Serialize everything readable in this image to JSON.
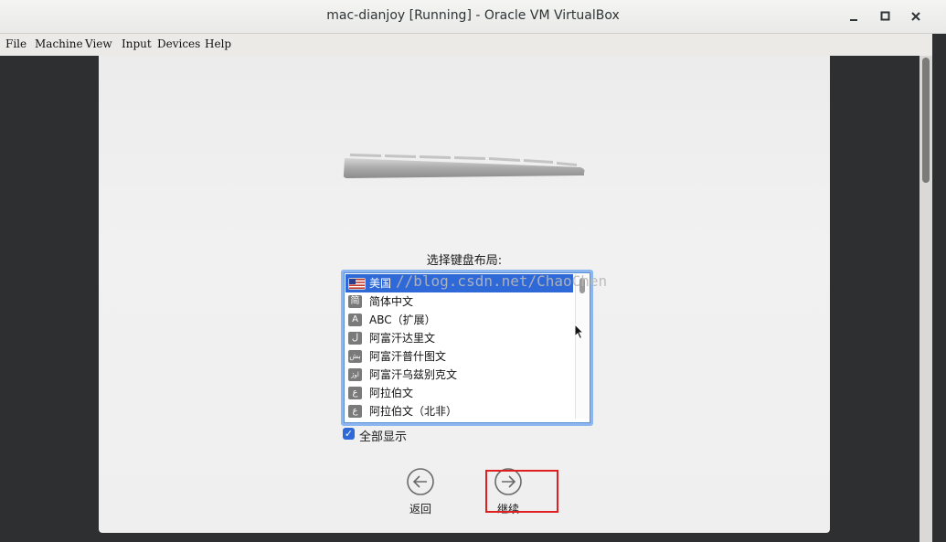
{
  "window": {
    "title": "mac-dianjoy [Running] - Oracle VM VirtualBox",
    "controls": [
      "minimize-icon",
      "maximize-icon",
      "close-icon"
    ]
  },
  "menubar": {
    "items": [
      "File",
      "Machine",
      "View",
      "Input",
      "Devices",
      "Help"
    ]
  },
  "installer": {
    "prompt": "选择键盘布局:",
    "layouts": [
      {
        "icon": "us-flag-icon",
        "glyph": "",
        "label": "美国",
        "selected": true
      },
      {
        "icon": "simplified-chinese-icon",
        "glyph": "简",
        "label": "简体中文",
        "selected": false
      },
      {
        "icon": "abc-letter-icon",
        "glyph": "A",
        "label": "ABC（扩展）",
        "selected": false
      },
      {
        "icon": "arabic-script-icon",
        "glyph": "ل",
        "label": "阿富汗达里文",
        "selected": false
      },
      {
        "icon": "pashto-script-icon",
        "glyph": "بش",
        "label": "阿富汗普什图文",
        "selected": false
      },
      {
        "icon": "uzbek-script-icon",
        "glyph": "اوژ",
        "label": "阿富汗乌兹别克文",
        "selected": false
      },
      {
        "icon": "arabic-script-icon",
        "glyph": "ع",
        "label": "阿拉伯文",
        "selected": false
      },
      {
        "icon": "arabic-script-icon",
        "glyph": "ع",
        "label": "阿拉伯文（北非）",
        "selected": false
      }
    ],
    "show_all": {
      "label": "全部显示",
      "checked": true
    },
    "back_label": "返回",
    "continue_label": "继续"
  },
  "watermark": "//blog.csdn.net/ChaoChen",
  "colors": {
    "selection": "#2f69d8",
    "focus_ring": "#8bb6ef",
    "highlight_box": "#e02020"
  }
}
